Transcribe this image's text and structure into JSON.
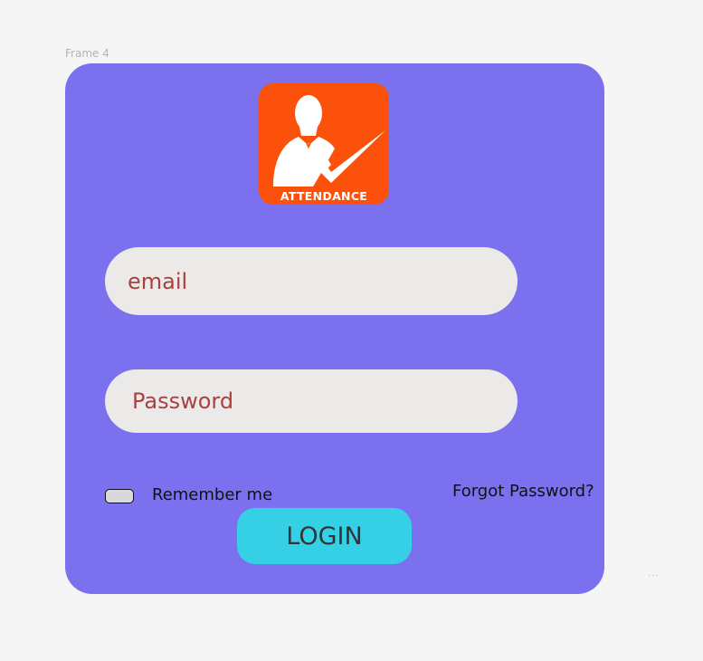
{
  "frame": {
    "label": "Frame 4",
    "background_color": "#7b71ee"
  },
  "logo": {
    "text": "ATTENDANCE",
    "icon": "person-check-icon",
    "background_color": "#fc510b"
  },
  "form": {
    "email_placeholder": "email",
    "password_placeholder": "Password",
    "remember_label": "Remember me",
    "remember_checked": false,
    "forgot_label": "Forgot Password?",
    "login_label": "LOGIN",
    "login_color": "#36d0e6",
    "placeholder_color": "#a94141"
  },
  "canvas": {
    "overflow_icon": "ellipsis-icon",
    "overflow_text": "..."
  }
}
